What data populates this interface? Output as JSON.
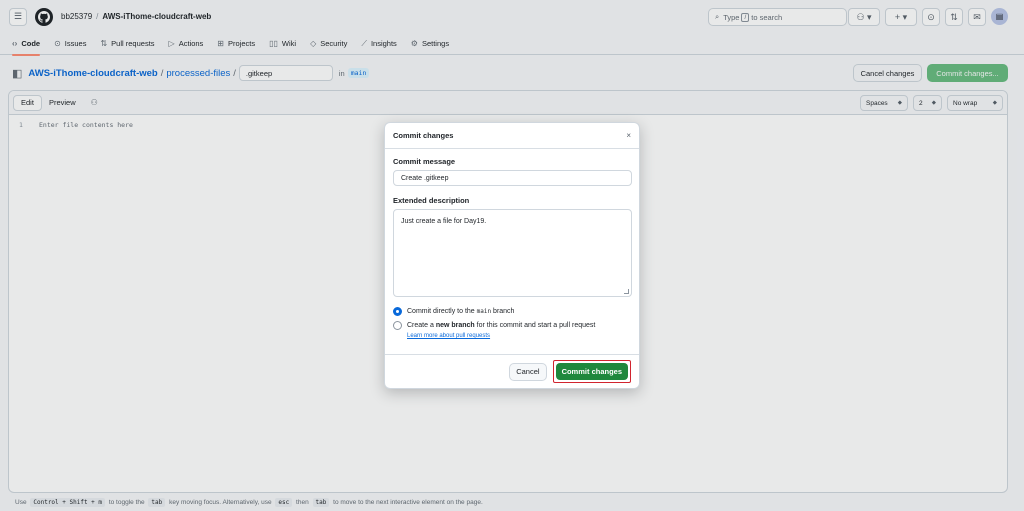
{
  "header": {
    "owner": "bb25379",
    "separator": "/",
    "repo": "AWS-iThome-cloudcraft-web",
    "search_prefix": "Type",
    "search_key": "/",
    "search_suffix": "to search"
  },
  "tabs": [
    {
      "label": "Code",
      "icon": "code-icon"
    },
    {
      "label": "Issues",
      "icon": "issue-icon"
    },
    {
      "label": "Pull requests",
      "icon": "pull-request-icon"
    },
    {
      "label": "Actions",
      "icon": "play-icon"
    },
    {
      "label": "Projects",
      "icon": "table-icon"
    },
    {
      "label": "Wiki",
      "icon": "book-icon"
    },
    {
      "label": "Security",
      "icon": "shield-icon"
    },
    {
      "label": "Insights",
      "icon": "graph-icon"
    },
    {
      "label": "Settings",
      "icon": "gear-icon"
    }
  ],
  "path": {
    "repo": "AWS-iThome-cloudcraft-web",
    "dir": "processed-files",
    "slash": "/",
    "filename": ".gitkeep",
    "in_label": "in",
    "branch": "main",
    "cancel_label": "Cancel changes",
    "commit_label": "Commit changes..."
  },
  "editor": {
    "edit_tab": "Edit",
    "preview_tab": "Preview",
    "indent_mode": "Spaces",
    "indent_size": "2",
    "wrap_mode": "No wrap",
    "line_number": "1",
    "placeholder": "Enter file contents here"
  },
  "footer": {
    "t1": "Use",
    "k1": "Control + Shift + m",
    "t2": "to toggle the",
    "k2": "tab",
    "t3": "key moving focus. Alternatively, use",
    "k3": "esc",
    "t4": "then",
    "k4": "tab",
    "t5": "to move to the next interactive element on the page."
  },
  "modal": {
    "title": "Commit changes",
    "close": "×",
    "message_label": "Commit message",
    "message_value": "Create .gitkeep",
    "desc_label": "Extended description",
    "desc_value": "Just create a file for Day19.",
    "option1_prefix": "Commit directly to the",
    "option1_branch": "main",
    "option1_suffix": "branch",
    "option2_prefix": "Create a",
    "option2_bold": "new branch",
    "option2_suffix": "for this commit and start a pull request",
    "learn_more": "Learn more about pull requests",
    "cancel_label": "Cancel",
    "commit_label": "Commit changes"
  },
  "colors": {
    "accent": "#0969da",
    "commit_green": "#1f883d",
    "highlight_red": "#d1242f"
  }
}
